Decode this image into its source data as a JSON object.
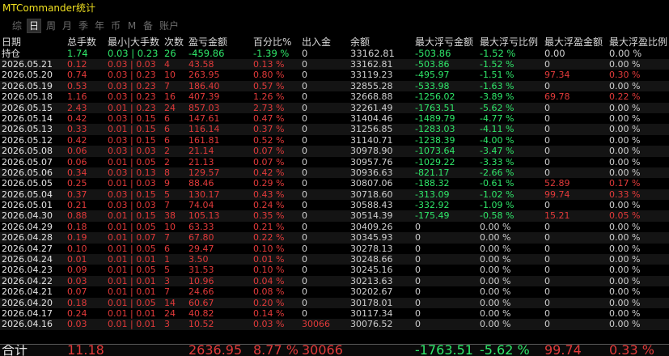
{
  "app": {
    "title": "MTCommander统计"
  },
  "tabs": [
    {
      "label": "综",
      "active": false
    },
    {
      "label": "日",
      "active": true
    },
    {
      "label": "周",
      "active": false
    },
    {
      "label": "月",
      "active": false
    },
    {
      "label": "季",
      "active": false
    },
    {
      "label": "年",
      "active": false
    },
    {
      "label": "币",
      "active": false
    },
    {
      "label": "M",
      "active": false
    },
    {
      "label": "备",
      "active": false
    },
    {
      "label": "账户",
      "active": false
    }
  ],
  "colors": {
    "loss": "#e23a3a",
    "profit": "#2fe86a",
    "title": "#f0e020"
  },
  "columns": [
    "日期",
    "总手数",
    "最小|大手数",
    "次数",
    "盈亏金额",
    "百分比%",
    "出入金",
    "余额",
    "最大浮亏金额",
    "最大浮亏比例",
    "最大浮盈金额",
    "最大浮盈比例"
  ],
  "position_row": {
    "date": "持仓",
    "lots": "1.74",
    "range": "0.03 | 0.23",
    "count": "26",
    "pnl": "-459.86",
    "pct": "-1.39 %",
    "io": "0",
    "balance": "33162.81",
    "max_float_loss": "-503.86",
    "max_float_loss_pct": "-1.52 %",
    "max_float_profit": "0.00",
    "max_float_profit_pct": "0.00 %"
  },
  "rows": [
    {
      "date": "2026.05.21",
      "lots": "0.12",
      "range": "0.03 | 0.03",
      "count": "4",
      "pnl": "43.58",
      "pct": "0.13 %",
      "io": "0",
      "balance": "33162.81",
      "mfl": "-503.86",
      "mflp": "-1.52 %",
      "mfp": "0",
      "mfpp": "0.00 %"
    },
    {
      "date": "2026.05.20",
      "lots": "0.74",
      "range": "0.03 | 0.23",
      "count": "10",
      "pnl": "263.95",
      "pct": "0.80 %",
      "io": "0",
      "balance": "33119.23",
      "mfl": "-495.97",
      "mflp": "-1.51 %",
      "mfp": "97.34",
      "mfpp": "0.30 %"
    },
    {
      "date": "2026.05.19",
      "lots": "0.53",
      "range": "0.03 | 0.23",
      "count": "7",
      "pnl": "186.40",
      "pct": "0.57 %",
      "io": "0",
      "balance": "32855.28",
      "mfl": "-533.98",
      "mflp": "-1.63 %",
      "mfp": "0",
      "mfpp": "0.00 %"
    },
    {
      "date": "2026.05.18",
      "lots": "1.16",
      "range": "0.03 | 0.23",
      "count": "16",
      "pnl": "407.39",
      "pct": "1.26 %",
      "io": "0",
      "balance": "32668.88",
      "mfl": "-1256.02",
      "mflp": "-3.89 %",
      "mfp": "69.78",
      "mfpp": "0.22 %"
    },
    {
      "date": "2026.05.15",
      "lots": "2.43",
      "range": "0.01 | 0.23",
      "count": "24",
      "pnl": "857.03",
      "pct": "2.73 %",
      "io": "0",
      "balance": "32261.49",
      "mfl": "-1763.51",
      "mflp": "-5.62 %",
      "mfp": "0",
      "mfpp": "0.00 %"
    },
    {
      "date": "2026.05.14",
      "lots": "0.42",
      "range": "0.03 | 0.15",
      "count": "6",
      "pnl": "147.61",
      "pct": "0.47 %",
      "io": "0",
      "balance": "31404.46",
      "mfl": "-1489.79",
      "mflp": "-4.77 %",
      "mfp": "0",
      "mfpp": "0.00 %"
    },
    {
      "date": "2026.05.13",
      "lots": "0.33",
      "range": "0.01 | 0.15",
      "count": "6",
      "pnl": "116.14",
      "pct": "0.37 %",
      "io": "0",
      "balance": "31256.85",
      "mfl": "-1283.03",
      "mflp": "-4.11 %",
      "mfp": "0",
      "mfpp": "0.00 %"
    },
    {
      "date": "2026.05.12",
      "lots": "0.42",
      "range": "0.03 | 0.15",
      "count": "6",
      "pnl": "161.81",
      "pct": "0.52 %",
      "io": "0",
      "balance": "31140.71",
      "mfl": "-1238.39",
      "mflp": "-4.00 %",
      "mfp": "0",
      "mfpp": "0.00 %"
    },
    {
      "date": "2026.05.08",
      "lots": "0.06",
      "range": "0.03 | 0.03",
      "count": "2",
      "pnl": "21.14",
      "pct": "0.07 %",
      "io": "0",
      "balance": "30978.90",
      "mfl": "-1073.64",
      "mflp": "-3.47 %",
      "mfp": "0",
      "mfpp": "0.00 %"
    },
    {
      "date": "2026.05.07",
      "lots": "0.06",
      "range": "0.01 | 0.05",
      "count": "2",
      "pnl": "21.13",
      "pct": "0.07 %",
      "io": "0",
      "balance": "30957.76",
      "mfl": "-1029.22",
      "mflp": "-3.33 %",
      "mfp": "0",
      "mfpp": "0.00 %"
    },
    {
      "date": "2026.05.06",
      "lots": "0.34",
      "range": "0.03 | 0.13",
      "count": "8",
      "pnl": "129.57",
      "pct": "0.42 %",
      "io": "0",
      "balance": "30936.63",
      "mfl": "-821.17",
      "mflp": "-2.66 %",
      "mfp": "0",
      "mfpp": "0.00 %"
    },
    {
      "date": "2026.05.05",
      "lots": "0.25",
      "range": "0.01 | 0.03",
      "count": "9",
      "pnl": "88.46",
      "pct": "0.29 %",
      "io": "0",
      "balance": "30807.06",
      "mfl": "-188.32",
      "mflp": "-0.61 %",
      "mfp": "52.89",
      "mfpp": "0.17 %"
    },
    {
      "date": "2026.05.04",
      "lots": "0.37",
      "range": "0.03 | 0.15",
      "count": "5",
      "pnl": "130.17",
      "pct": "0.43 %",
      "io": "0",
      "balance": "30718.60",
      "mfl": "-313.09",
      "mflp": "-1.02 %",
      "mfp": "99.74",
      "mfpp": "0.33 %"
    },
    {
      "date": "2026.05.01",
      "lots": "0.21",
      "range": "0.03 | 0.03",
      "count": "7",
      "pnl": "74.04",
      "pct": "0.24 %",
      "io": "0",
      "balance": "30588.43",
      "mfl": "-332.92",
      "mflp": "-1.09 %",
      "mfp": "0",
      "mfpp": "0.00 %"
    },
    {
      "date": "2026.04.30",
      "lots": "0.88",
      "range": "0.01 | 0.15",
      "count": "38",
      "pnl": "105.13",
      "pct": "0.35 %",
      "io": "0",
      "balance": "30514.39",
      "mfl": "-175.49",
      "mflp": "-0.58 %",
      "mfp": "15.21",
      "mfpp": "0.05 %"
    },
    {
      "date": "2026.04.29",
      "lots": "0.18",
      "range": "0.01 | 0.05",
      "count": "10",
      "pnl": "63.33",
      "pct": "0.21 %",
      "io": "0",
      "balance": "30409.26",
      "mfl": "0",
      "mflp": "0.00 %",
      "mfp": "0",
      "mfpp": "0.00 %"
    },
    {
      "date": "2026.04.28",
      "lots": "0.19",
      "range": "0.01 | 0.07",
      "count": "7",
      "pnl": "67.80",
      "pct": "0.22 %",
      "io": "0",
      "balance": "30345.93",
      "mfl": "0",
      "mflp": "0.00 %",
      "mfp": "0",
      "mfpp": "0.00 %"
    },
    {
      "date": "2026.04.27",
      "lots": "0.10",
      "range": "0.01 | 0.05",
      "count": "6",
      "pnl": "29.47",
      "pct": "0.10 %",
      "io": "0",
      "balance": "30278.13",
      "mfl": "0",
      "mflp": "0.00 %",
      "mfp": "0",
      "mfpp": "0.00 %"
    },
    {
      "date": "2026.04.24",
      "lots": "0.01",
      "range": "0.01 | 0.01",
      "count": "1",
      "pnl": "3.50",
      "pct": "0.01 %",
      "io": "0",
      "balance": "30248.66",
      "mfl": "0",
      "mflp": "0.00 %",
      "mfp": "0",
      "mfpp": "0.00 %"
    },
    {
      "date": "2026.04.23",
      "lots": "0.09",
      "range": "0.01 | 0.05",
      "count": "5",
      "pnl": "31.53",
      "pct": "0.10 %",
      "io": "0",
      "balance": "30245.16",
      "mfl": "0",
      "mflp": "0.00 %",
      "mfp": "0",
      "mfpp": "0.00 %"
    },
    {
      "date": "2026.04.22",
      "lots": "0.03",
      "range": "0.01 | 0.01",
      "count": "3",
      "pnl": "10.96",
      "pct": "0.04 %",
      "io": "0",
      "balance": "30213.63",
      "mfl": "0",
      "mflp": "0.00 %",
      "mfp": "0",
      "mfpp": "0.00 %"
    },
    {
      "date": "2026.04.21",
      "lots": "0.07",
      "range": "0.01 | 0.01",
      "count": "7",
      "pnl": "24.66",
      "pct": "0.08 %",
      "io": "0",
      "balance": "30202.67",
      "mfl": "0",
      "mflp": "0.00 %",
      "mfp": "0",
      "mfpp": "0.00 %"
    },
    {
      "date": "2026.04.20",
      "lots": "0.18",
      "range": "0.01 | 0.05",
      "count": "14",
      "pnl": "60.67",
      "pct": "0.20 %",
      "io": "0",
      "balance": "30178.01",
      "mfl": "0",
      "mflp": "0.00 %",
      "mfp": "0",
      "mfpp": "0.00 %"
    },
    {
      "date": "2026.04.17",
      "lots": "0.24",
      "range": "0.01 | 0.01",
      "count": "24",
      "pnl": "40.82",
      "pct": "0.14 %",
      "io": "0",
      "balance": "30117.34",
      "mfl": "0",
      "mflp": "0.00 %",
      "mfp": "0",
      "mfpp": "0.00 %"
    },
    {
      "date": "2026.04.16",
      "lots": "0.03",
      "range": "0.01 | 0.01",
      "count": "3",
      "pnl": "10.52",
      "pct": "0.03 %",
      "io": "30066",
      "balance": "30076.52",
      "mfl": "0",
      "mflp": "0.00 %",
      "mfp": "0",
      "mfpp": "0.00 %"
    }
  ],
  "total_row": {
    "label": "合计",
    "lots": "11.18",
    "range": "",
    "count": "",
    "pnl": "2636.95",
    "pct": "8.77 %",
    "io": "30066",
    "balance": "",
    "mfl": "-1763.51",
    "mflp": "-5.62 %",
    "mfp": "99.74",
    "mfpp": "0.33 %"
  }
}
